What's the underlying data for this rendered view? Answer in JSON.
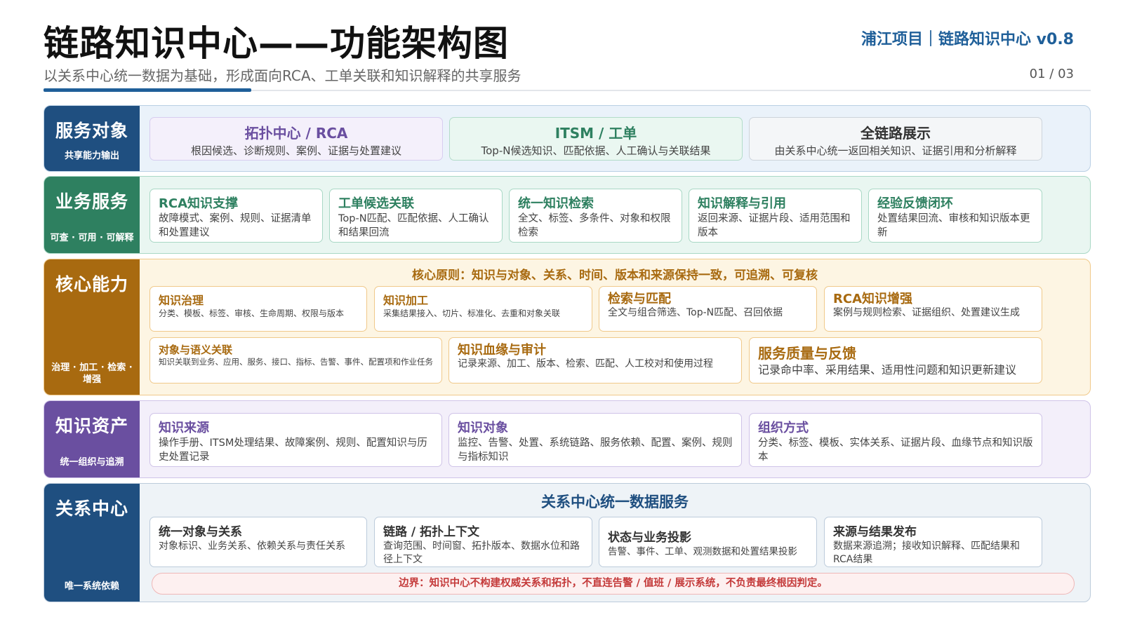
{
  "header": {
    "title": "链路知识中心——功能架构图",
    "subtitle": "以关系中心统一数据为基础，形成面向RCA、工单关联和知识解释的共享服务",
    "brand": "浦江项目｜链路知识中心 v0.8",
    "page": "01 / 03"
  },
  "bands": {
    "service_objects": {
      "title": "服务对象",
      "subtitle": "共享能力输出",
      "color": "#1f4f80",
      "cards": [
        {
          "title": "拓扑中心 / RCA",
          "desc": "根因候选、诊断规则、案例、证据与处置建议",
          "color": "#6a4fa0",
          "bg": "#f4f0fb",
          "border": "#d7cdef"
        },
        {
          "title": "ITSM / 工单",
          "desc": "Top-N候选知识、匹配依据、人工确认与关联结果",
          "color": "#2e8060",
          "bg": "#eaf7f1",
          "border": "#b3dcc9"
        },
        {
          "title": "全链路展示",
          "desc": "由关系中心统一返回相关知识、证据引用和分析解释",
          "color": "#333333",
          "bg": "#f4f6f8",
          "border": "#cdd4db"
        }
      ]
    },
    "business_services": {
      "title": "业务服务",
      "subtitle": "可查 · 可用 · 可解释",
      "color": "#2e8060",
      "cards": [
        {
          "title": "RCA知识支撑",
          "desc": "故障模式、案例、规则、证据清单和处置建议"
        },
        {
          "title": "工单候选关联",
          "desc": "Top-N匹配、匹配依据、人工确认和结果回流"
        },
        {
          "title": "统一知识检索",
          "desc": "全文、标签、多条件、对象和权限检索"
        },
        {
          "title": "知识解释与引用",
          "desc": "返回来源、证据片段、适用范围和版本"
        },
        {
          "title": "经验反馈闭环",
          "desc": "处置结果回流、审核和知识版本更新"
        }
      ]
    },
    "core_capabilities": {
      "title": "核心能力",
      "subtitle": "治理 · 加工 · 检索 · 增强",
      "color": "#a86a10",
      "principle": "核心原则：知识与对象、关系、时间、版本和来源保持一致，可追溯、可复核",
      "row1": [
        {
          "title": "知识治理",
          "desc": "分类、模板、标签、审核、生命周期、权限与版本"
        },
        {
          "title": "知识加工",
          "desc": "采集结果接入、切片、标准化、去重和对象关联"
        },
        {
          "title": "检索与匹配",
          "desc": "全文与组合筛选、Top-N匹配、召回依据"
        },
        {
          "title": "RCA知识增强",
          "desc": "案例与规则检索、证据组织、处置建议生成"
        }
      ],
      "row2": [
        {
          "title": "对象与语义关联",
          "desc": "知识关联到业务、应用、服务、接口、指标、告警、事件、配置项和作业任务"
        },
        {
          "title": "知识血缘与审计",
          "desc": "记录来源、加工、版本、检索、匹配、人工校对和使用过程"
        },
        {
          "title": "服务质量与反馈",
          "desc": "记录命中率、采用结果、适用性问题和知识更新建议"
        }
      ]
    },
    "knowledge_assets": {
      "title": "知识资产",
      "subtitle": "统一组织与追溯",
      "color": "#6a4fa0",
      "cards": [
        {
          "title": "知识来源",
          "desc": "操作手册、ITSM处理结果、故障案例、规则、配置知识与历史处置记录"
        },
        {
          "title": "知识对象",
          "desc": "监控、告警、处置、系统链路、服务依赖、配置、案例、规则与指标知识"
        },
        {
          "title": "组织方式",
          "desc": "分类、标签、模板、实体关系、证据片段、血缘节点和知识版本"
        }
      ]
    },
    "relation_center": {
      "title": "关系中心",
      "subtitle": "唯一系统依赖",
      "color": "#1f4f80",
      "center_title": "关系中心统一数据服务",
      "cards": [
        {
          "title": "统一对象与关系",
          "desc": "对象标识、业务关系、依赖关系与责任关系"
        },
        {
          "title": "链路 / 拓扑上下文",
          "desc": "查询范围、时间窗、拓扑版本、数据水位和路径上下文"
        },
        {
          "title": "状态与业务投影",
          "desc": "告警、事件、工单、观测数据和处置结果投影"
        },
        {
          "title": "来源与结果发布",
          "desc": "数据来源追溯；接收知识解释、匹配结果和RCA结果"
        }
      ],
      "boundary": "边界：知识中心不构建权威关系和拓扑，不直连告警 / 值班 / 展示系统，不负责最终根因判定。"
    }
  }
}
